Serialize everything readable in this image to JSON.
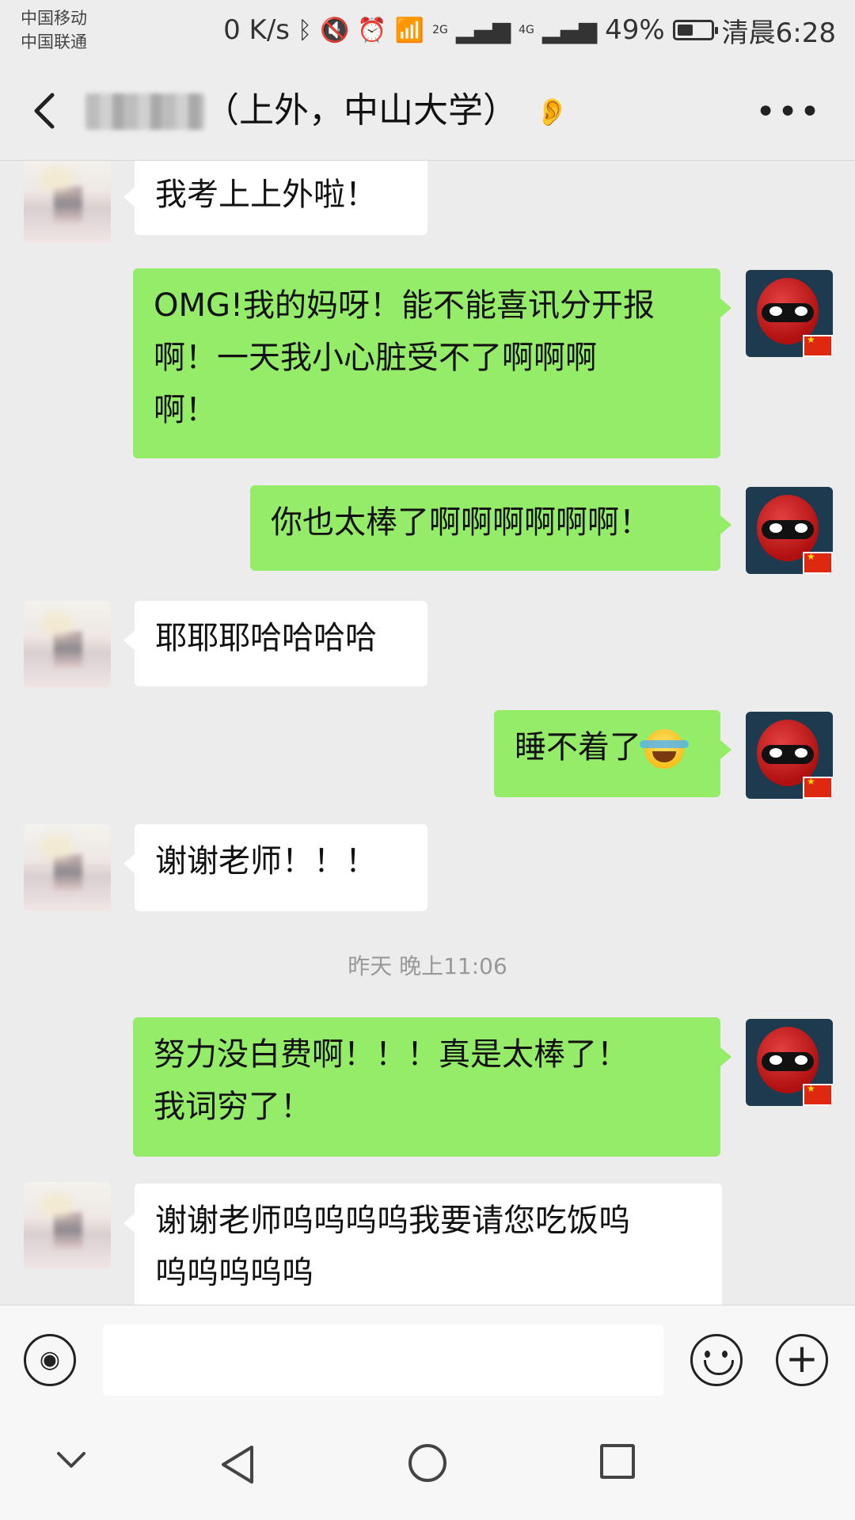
{
  "status_bar": {
    "carrier1": "中国移动",
    "carrier2": "中国联通",
    "net_speed": "0 K/s",
    "signal1": "2G",
    "signal2": "4G",
    "battery": "49%",
    "battery_level": 0.49,
    "time": "清晨6:28"
  },
  "header": {
    "title": "（上外，中山大学）"
  },
  "messages": [
    {
      "side": "left",
      "text": "我考上上外啦！"
    },
    {
      "side": "right",
      "lines": [
        "OMG!我的妈呀！能不能喜讯分开报",
        "啊！一天我小心脏受不了啊啊啊",
        "啊！"
      ]
    },
    {
      "side": "right",
      "text": "你也太棒了啊啊啊啊啊啊！"
    },
    {
      "side": "left",
      "text": "耶耶耶哈哈哈哈"
    },
    {
      "side": "right",
      "text": "睡不着了",
      "emoji": "laughing-crying-emoji"
    },
    {
      "side": "left",
      "text": "谢谢老师！！！"
    },
    {
      "type": "time",
      "text": "昨天 晚上11:06"
    },
    {
      "side": "right",
      "lines": [
        "努力没白费啊！！！真是太棒了！",
        "我词穷了！"
      ]
    },
    {
      "side": "left",
      "lines": [
        "谢谢老师呜呜呜呜我要请您吃饭呜",
        "呜呜呜呜呜"
      ]
    }
  ],
  "colors": {
    "green_bubble": "#95ec69",
    "white_bubble": "#ffffff",
    "background": "#ececec"
  }
}
